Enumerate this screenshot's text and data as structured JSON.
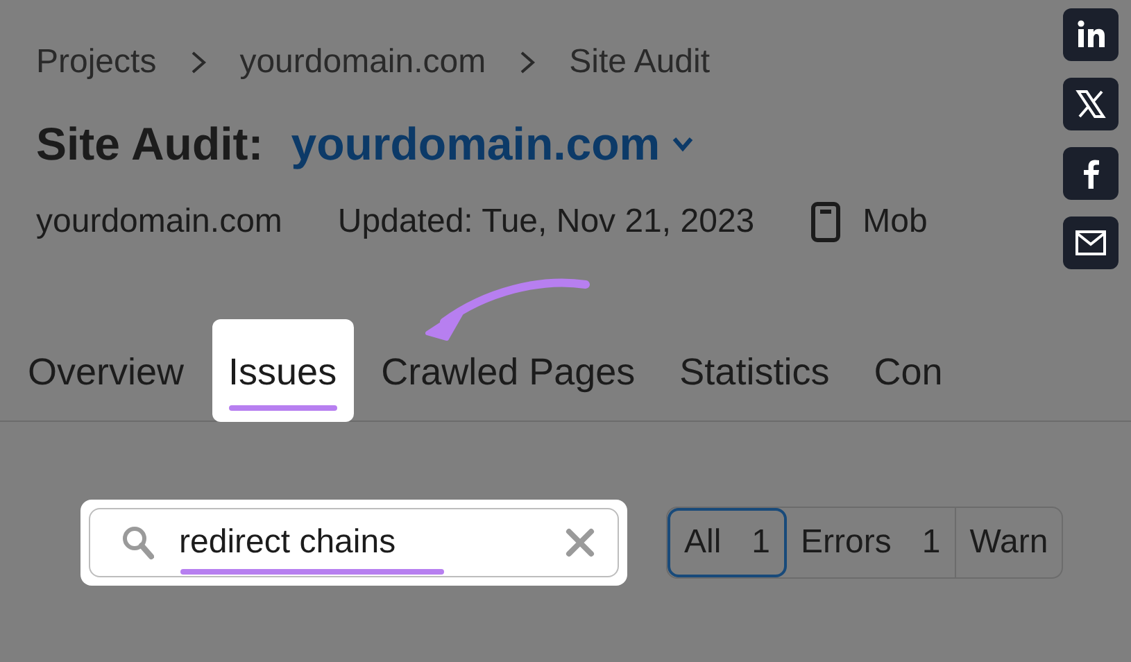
{
  "breadcrumbs": [
    "Projects",
    "yourdomain.com",
    "Site Audit"
  ],
  "title": {
    "label": "Site Audit:",
    "domain": "yourdomain.com"
  },
  "meta": {
    "domain": "yourdomain.com",
    "updated": "Updated: Tue, Nov 21, 2023",
    "device": "Mob"
  },
  "tabs": [
    {
      "label": "Overview",
      "selected": false
    },
    {
      "label": "Issues",
      "selected": true
    },
    {
      "label": "Crawled Pages",
      "selected": false
    },
    {
      "label": "Statistics",
      "selected": false
    },
    {
      "label": "Con",
      "selected": false
    }
  ],
  "search": {
    "value": "redirect chains"
  },
  "filters": [
    {
      "label": "All",
      "count": "1",
      "selected": true
    },
    {
      "label": "Errors",
      "count": "1",
      "selected": false
    },
    {
      "label": "Warn",
      "selected": false
    }
  ],
  "share": [
    {
      "kind": "linkedin"
    },
    {
      "kind": "x"
    },
    {
      "kind": "facebook"
    },
    {
      "kind": "mail"
    }
  ]
}
